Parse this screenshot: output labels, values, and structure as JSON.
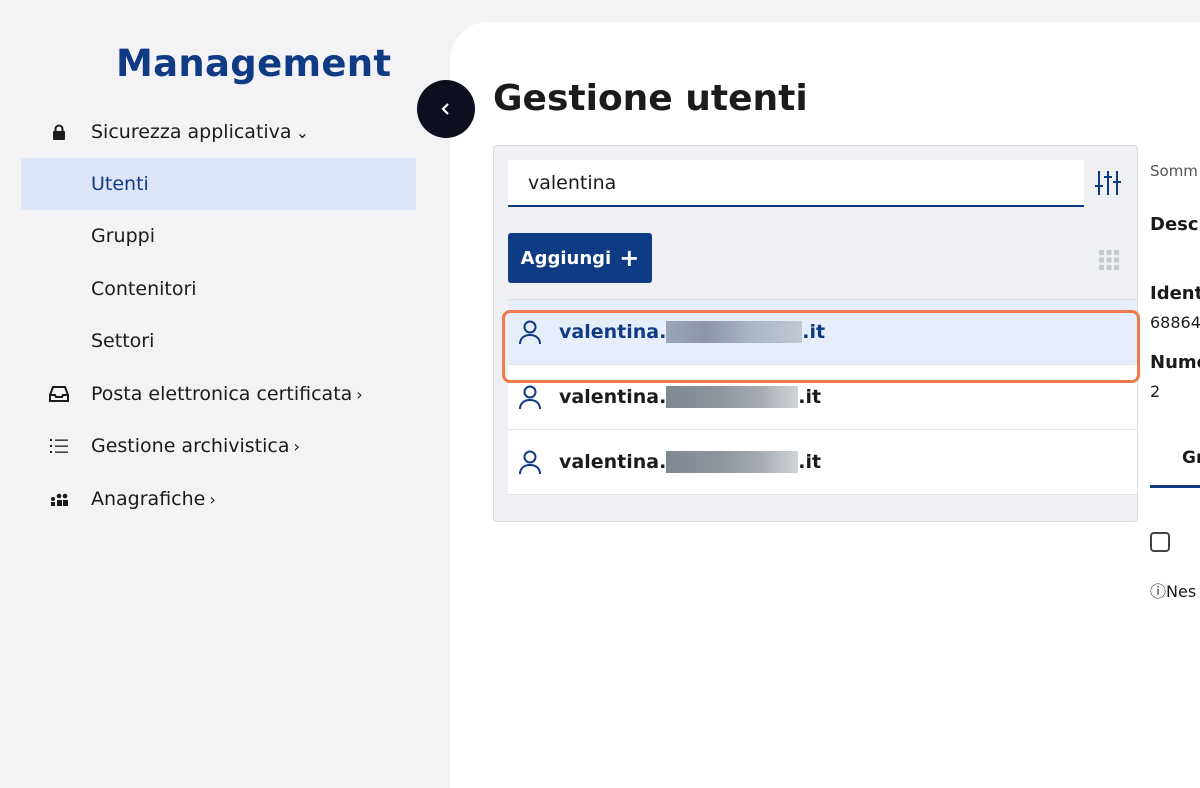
{
  "app_title": "Management",
  "sidebar": {
    "sections": [
      {
        "label": "Sicurezza applicativa",
        "chevron": "⌄",
        "icon": "lock-icon"
      },
      {
        "label": "Posta elettronica certificata",
        "chevron": "›",
        "icon": "inbox-icon"
      },
      {
        "label": "Gestione archivistica",
        "chevron": "›",
        "icon": "list-icon"
      },
      {
        "label": "Anagrafiche",
        "chevron": "›",
        "icon": "people-icon"
      }
    ],
    "items": [
      {
        "label": "Utenti",
        "active": true
      },
      {
        "label": "Gruppi"
      },
      {
        "label": "Contenitori"
      },
      {
        "label": "Settori"
      }
    ]
  },
  "page_title": "Gestione utenti",
  "search": {
    "value": "valentina"
  },
  "add_button": {
    "label": "Aggiungi",
    "icon": "+"
  },
  "users": [
    {
      "prefix": "valentina.",
      "suffix": ".it",
      "selected": true
    },
    {
      "prefix": "valentina.",
      "suffix": ".it"
    },
    {
      "prefix": "valentina.",
      "suffix": ".it"
    }
  ],
  "detail": {
    "summary_label": "Somm",
    "description_label": "Desc",
    "identifier_label": "Ident",
    "identifier_value": "68864",
    "number_label": "Nume",
    "number_value": "2",
    "tab_label": "Gr",
    "info_text": "Nes"
  },
  "colors": {
    "accent": "#0f3a84",
    "highlight": "#f07a4a",
    "active_bg": "#dde6f7"
  }
}
